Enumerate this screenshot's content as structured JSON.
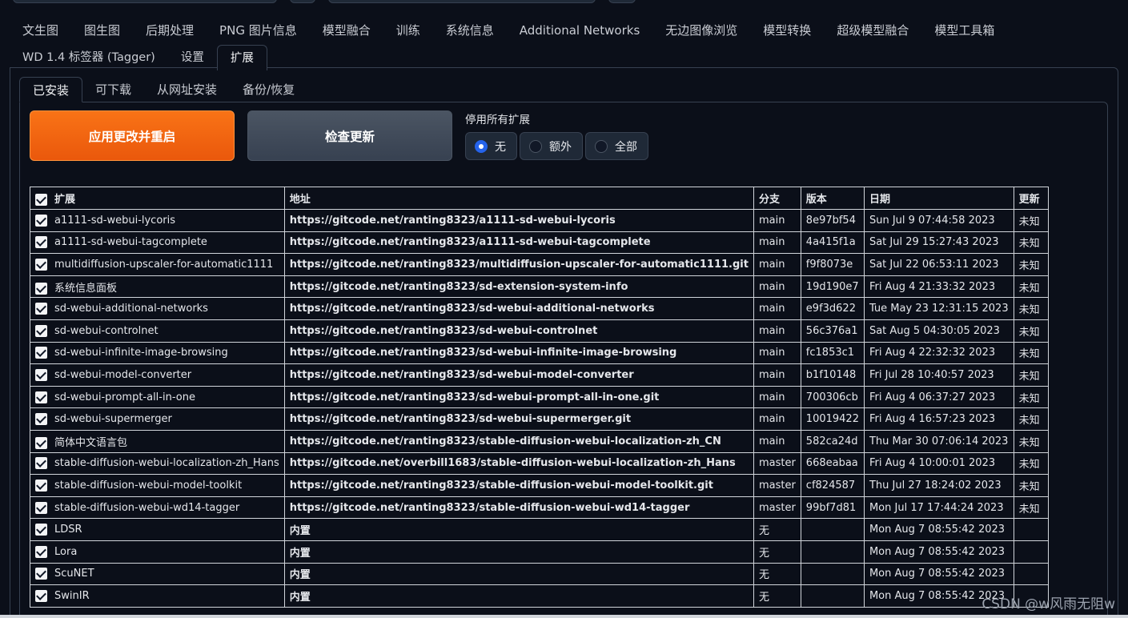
{
  "main_tabs_row1": [
    "文生图",
    "图生图",
    "后期处理",
    "PNG 图片信息",
    "模型融合",
    "训练",
    "系统信息",
    "Additional Networks",
    "无边图像浏览",
    "模型转换",
    "超级模型融合",
    "模型工具箱"
  ],
  "main_tabs_row2": [
    "WD 1.4 标签器 (Tagger)",
    "设置",
    "扩展"
  ],
  "active_main_tab": "扩展",
  "sub_tabs": [
    "已安装",
    "可下载",
    "从网址安装",
    "备份/恢复"
  ],
  "active_sub_tab": "已安装",
  "buttons": {
    "apply": "应用更改并重启",
    "check": "检查更新"
  },
  "disable_all": {
    "label": "停用所有扩展",
    "options": [
      "无",
      "额外",
      "全部"
    ],
    "selected": "无"
  },
  "table": {
    "headers": {
      "name": "扩展",
      "url": "地址",
      "branch": "分支",
      "version": "版本",
      "date": "日期",
      "update": "更新"
    },
    "rows": [
      {
        "name": "a1111-sd-webui-lycoris",
        "url": "https://gitcode.net/ranting8323/a1111-sd-webui-lycoris",
        "branch": "main",
        "version": "8e97bf54",
        "date": "Sun Jul 9 07:44:58 2023",
        "update": "未知"
      },
      {
        "name": "a1111-sd-webui-tagcomplete",
        "url": "https://gitcode.net/ranting8323/a1111-sd-webui-tagcomplete",
        "branch": "main",
        "version": "4a415f1a",
        "date": "Sat Jul 29 15:27:43 2023",
        "update": "未知"
      },
      {
        "name": "multidiffusion-upscaler-for-automatic1111",
        "url": "https://gitcode.net/ranting8323/multidiffusion-upscaler-for-automatic1111.git",
        "branch": "main",
        "version": "f9f8073e",
        "date": "Sat Jul 22 06:53:11 2023",
        "update": "未知"
      },
      {
        "name": "系统信息面板",
        "url": "https://gitcode.net/ranting8323/sd-extension-system-info",
        "branch": "main",
        "version": "19d190e7",
        "date": "Fri Aug 4 21:33:32 2023",
        "update": "未知"
      },
      {
        "name": "sd-webui-additional-networks",
        "url": "https://gitcode.net/ranting8323/sd-webui-additional-networks",
        "branch": "main",
        "version": "e9f3d622",
        "date": "Tue May 23 12:31:15 2023",
        "update": "未知"
      },
      {
        "name": "sd-webui-controlnet",
        "url": "https://gitcode.net/ranting8323/sd-webui-controlnet",
        "branch": "main",
        "version": "56c376a1",
        "date": "Sat Aug 5 04:30:05 2023",
        "update": "未知"
      },
      {
        "name": "sd-webui-infinite-image-browsing",
        "url": "https://gitcode.net/ranting8323/sd-webui-infinite-image-browsing",
        "branch": "main",
        "version": "fc1853c1",
        "date": "Fri Aug 4 22:32:32 2023",
        "update": "未知"
      },
      {
        "name": "sd-webui-model-converter",
        "url": "https://gitcode.net/ranting8323/sd-webui-model-converter",
        "branch": "main",
        "version": "b1f10148",
        "date": "Fri Jul 28 10:40:57 2023",
        "update": "未知"
      },
      {
        "name": "sd-webui-prompt-all-in-one",
        "url": "https://gitcode.net/ranting8323/sd-webui-prompt-all-in-one.git",
        "branch": "main",
        "version": "700306cb",
        "date": "Fri Aug 4 06:37:27 2023",
        "update": "未知"
      },
      {
        "name": "sd-webui-supermerger",
        "url": "https://gitcode.net/ranting8323/sd-webui-supermerger.git",
        "branch": "main",
        "version": "10019422",
        "date": "Fri Aug 4 16:57:23 2023",
        "update": "未知"
      },
      {
        "name": "简体中文语言包",
        "url": "https://gitcode.net/ranting8323/stable-diffusion-webui-localization-zh_CN",
        "branch": "main",
        "version": "582ca24d",
        "date": "Thu Mar 30 07:06:14 2023",
        "update": "未知"
      },
      {
        "name": "stable-diffusion-webui-localization-zh_Hans",
        "url": "https://gitcode.net/overbill1683/stable-diffusion-webui-localization-zh_Hans",
        "branch": "master",
        "version": "668eabaa",
        "date": "Fri Aug 4 10:00:01 2023",
        "update": "未知"
      },
      {
        "name": "stable-diffusion-webui-model-toolkit",
        "url": "https://gitcode.net/ranting8323/stable-diffusion-webui-model-toolkit.git",
        "branch": "master",
        "version": "cf824587",
        "date": "Thu Jul 27 18:24:02 2023",
        "update": "未知"
      },
      {
        "name": "stable-diffusion-webui-wd14-tagger",
        "url": "https://gitcode.net/ranting8323/stable-diffusion-webui-wd14-tagger",
        "branch": "master",
        "version": "99bf7d81",
        "date": "Mon Jul 17 17:44:24 2023",
        "update": "未知"
      },
      {
        "name": "LDSR",
        "url": "内置",
        "branch": "无",
        "version": "",
        "date": "Mon Aug 7 08:55:42 2023",
        "update": ""
      },
      {
        "name": "Lora",
        "url": "内置",
        "branch": "无",
        "version": "",
        "date": "Mon Aug 7 08:55:42 2023",
        "update": ""
      },
      {
        "name": "ScuNET",
        "url": "内置",
        "branch": "无",
        "version": "",
        "date": "Mon Aug 7 08:55:42 2023",
        "update": ""
      },
      {
        "name": "SwinIR",
        "url": "内置",
        "branch": "无",
        "version": "",
        "date": "Mon Aug 7 08:55:42 2023",
        "update": ""
      }
    ]
  },
  "watermark": "CSDN @w风雨无阻w"
}
